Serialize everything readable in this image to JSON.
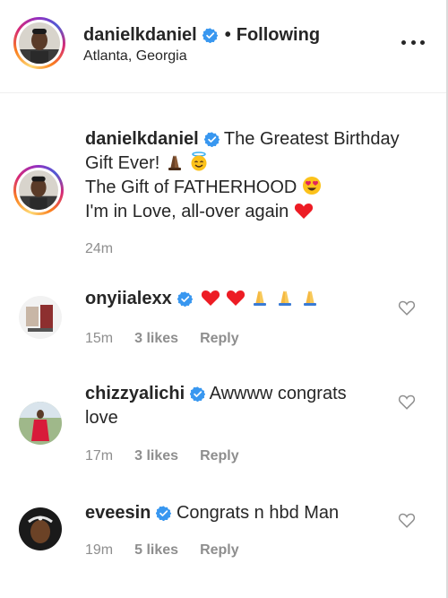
{
  "header": {
    "username": "danielkdaniel",
    "separator": "•",
    "following_label": "Following",
    "location": "Atlanta, Georgia",
    "more_icon": "more-horizontal-icon"
  },
  "caption": {
    "username": "danielkdaniel",
    "line1": "The Greatest Birthday",
    "line2": "Gift Ever!",
    "line3": "The Gift of FATHERHOOD",
    "line4": "I'm in Love, all-over again",
    "time": "24m"
  },
  "comments": [
    {
      "username": "onyiialexx",
      "text": "",
      "time": "15m",
      "likes": "3 likes",
      "reply": "Reply"
    },
    {
      "username": "chizzyalichi",
      "text": "Awwww congrats",
      "text2": "love",
      "time": "17m",
      "likes": "3 likes",
      "reply": "Reply"
    },
    {
      "username": "eveesin",
      "text": "Congrats n hbd Man",
      "time": "19m",
      "likes": "5 likes",
      "reply": "Reply"
    }
  ],
  "colors": {
    "verified": "#3897f0",
    "muted": "#8e8e8e",
    "text": "#262626",
    "heart": "#ed1c24"
  }
}
